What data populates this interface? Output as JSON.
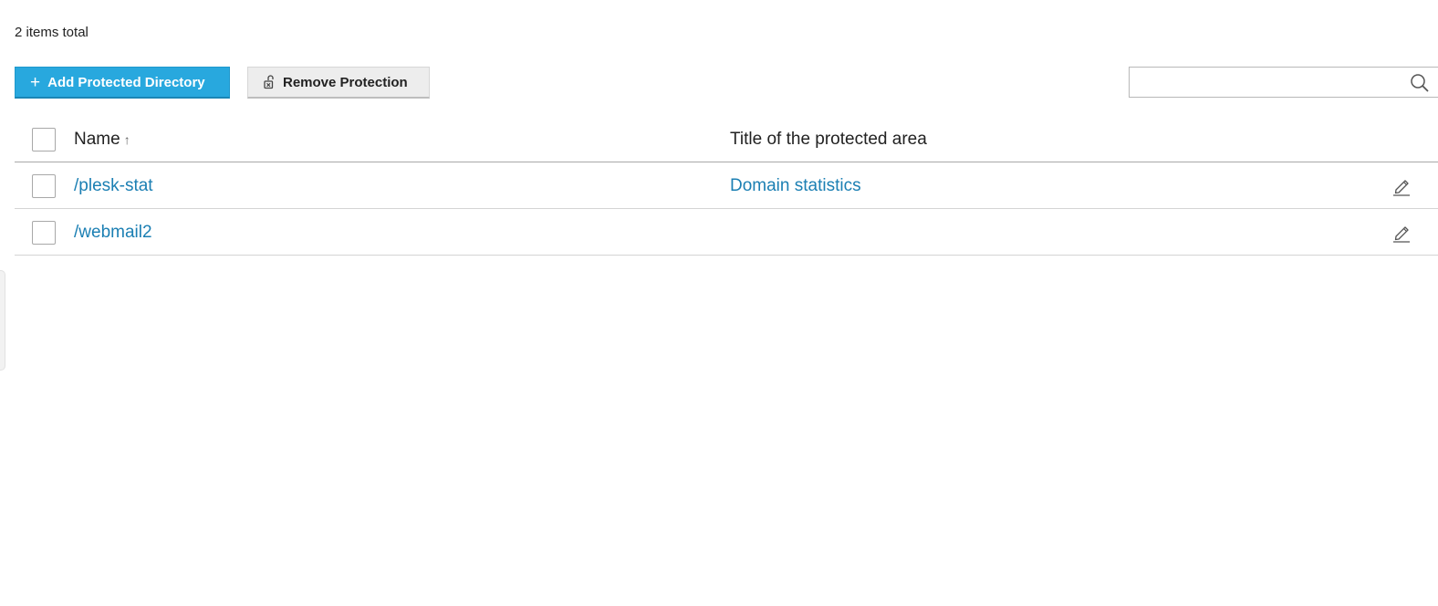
{
  "summary": {
    "items_total": "2 items total"
  },
  "toolbar": {
    "add_label": "Add Protected Directory",
    "add_icon": "plus-icon",
    "remove_label": "Remove Protection",
    "remove_icon": "unlock-icon"
  },
  "search": {
    "value": "",
    "placeholder": "",
    "icon": "search-icon"
  },
  "table": {
    "columns": {
      "name": "Name",
      "name_sort": "↑",
      "title": "Title of the protected area"
    },
    "rows": [
      {
        "name": "/plesk-stat",
        "title": "Domain statistics"
      },
      {
        "name": "/webmail2",
        "title": ""
      }
    ]
  },
  "colors": {
    "primary_button": "#28a8de",
    "link": "#1b7fb3"
  }
}
